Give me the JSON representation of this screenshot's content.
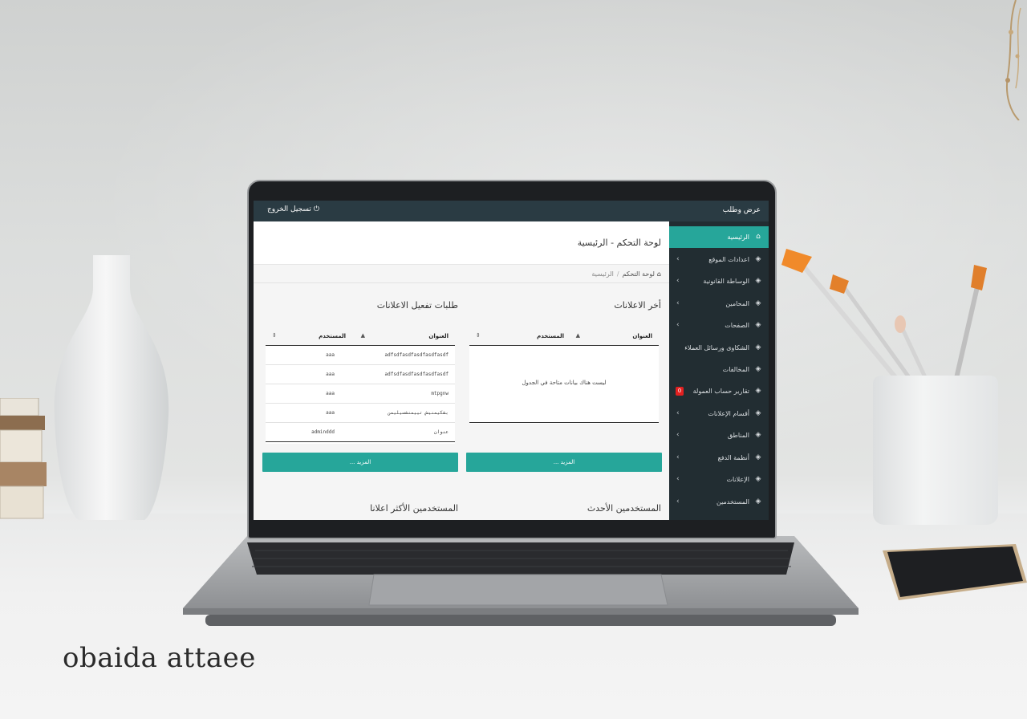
{
  "app": {
    "brand": "عرض وطلب",
    "logout_label": "تسجيل الخروج"
  },
  "sidebar": {
    "items": [
      {
        "label": "الرئيسية",
        "icon": "home-icon",
        "active": true,
        "has_submenu": false
      },
      {
        "label": "اعدادات الموقع",
        "icon": "layers-icon",
        "has_submenu": true
      },
      {
        "label": "الوساطة القانونية",
        "icon": "layers-icon",
        "has_submenu": true
      },
      {
        "label": "المحامين",
        "icon": "layers-icon",
        "has_submenu": true
      },
      {
        "label": "الصفحات",
        "icon": "layers-icon",
        "has_submenu": true
      },
      {
        "label": "الشكاوى ورسائل العملاء",
        "icon": "layers-icon",
        "has_submenu": false
      },
      {
        "label": "المخالفات",
        "icon": "layers-icon",
        "has_submenu": false
      },
      {
        "label": "تقارير حساب العمولة",
        "icon": "layers-icon",
        "has_submenu": false,
        "badge": "0"
      },
      {
        "label": "أقسام الإعلانات",
        "icon": "layers-icon",
        "has_submenu": true
      },
      {
        "label": "المناطق",
        "icon": "layers-icon",
        "has_submenu": true
      },
      {
        "label": "أنظمة الدفع",
        "icon": "layers-icon",
        "has_submenu": true
      },
      {
        "label": "الإعلانات",
        "icon": "layers-icon",
        "has_submenu": true
      },
      {
        "label": "المستخدمين",
        "icon": "layers-icon",
        "has_submenu": true
      }
    ]
  },
  "header": {
    "page_title": "لوحة التحكم - الرئيسية",
    "breadcrumb_home": "لوحة التحكم",
    "breadcrumb_current": "الرئيسية"
  },
  "latest_ads": {
    "title": "أخر الاعلانات",
    "col_title": "العنوان",
    "col_user": "المستخدم",
    "empty_text": "ليست هناك بيانات متاحة في الجدول",
    "more_label": "المزيد ..."
  },
  "activation_requests": {
    "title": "طلبات تفعيل الاعلانات",
    "col_title": "العنوان",
    "col_user": "المستخدم",
    "rows": [
      {
        "title": "adfsdfasdfasdfasdfasdf",
        "user": "aaa"
      },
      {
        "title": "adfsdfasdfasdfasdfasdf",
        "user": "aaa"
      },
      {
        "title": "mtpgnw",
        "user": "aaa"
      },
      {
        "title": "بشكيمنيش تييمنشسيليمن",
        "user": "aaa"
      },
      {
        "title": "عنوان",
        "user": "adminddd"
      }
    ],
    "more_label": "المزيد ..."
  },
  "bottom_sections": {
    "newest_users": "المستخدمين الأحدث",
    "top_advertisers": "المستخدمين الأكثر اعلانا"
  },
  "watermark": "obaida attaee",
  "colors": {
    "accent": "#26a69a",
    "topbar": "#2a3b43",
    "sidebar": "#222d32",
    "badge": "#e32020"
  }
}
